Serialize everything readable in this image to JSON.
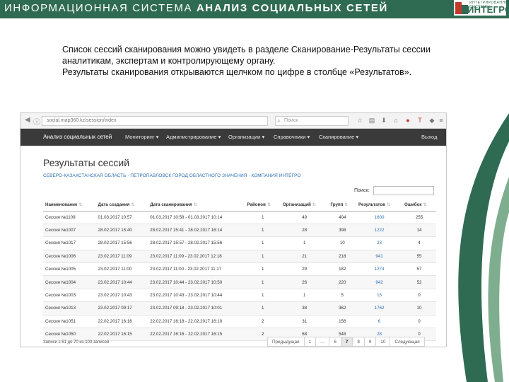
{
  "header": {
    "title_regular": "ИНФОРМАЦИОННАЯ СИСТЕМА ",
    "title_bold": "АНАЛИЗ СОЦИАЛЬНЫХ СЕТЕЙ",
    "logo_top": "ИНТЕГРИРОВАННЫЕ СИСТЕМЫ",
    "logo_text": "ИНТЕГРО"
  },
  "colors": {
    "brand_green": "#2f6b53",
    "link_blue": "#2a6fb5",
    "nav_dark": "#3a3a3a"
  },
  "description": {
    "line1": "Список сессий сканирования можно увидеть в разделе Сканирование-Результаты сессии",
    "line2": "аналитикам, экспертам и контролирующему органу.",
    "line3": "Результаты сканирования открываются щелчком по цифре в столбце «Результатов»."
  },
  "browser": {
    "address": "social.map360.kz/session/index",
    "search_placeholder": "Поиск",
    "toolbar_icons": [
      "star-icon",
      "reading-list-icon",
      "download-icon",
      "home-icon",
      "pocket-icon",
      "menu-icon"
    ]
  },
  "nav": {
    "brand": "Анализ социальных сетей",
    "items": [
      "Мониторинг ▾",
      "Администрирование ▾",
      "Организации ▾",
      "Справочники ▾",
      "Сканирование ▾"
    ],
    "logout": "Выход"
  },
  "page": {
    "title": "Результаты сессий",
    "breadcrumb": "СЕВЕРО-КАЗАХСТАНСКАЯ ОБЛАСТЬ  ·  ПЕТРОПАВЛОВСК ГОРОД ОБЛАСТНОГО ЗНАЧЕНИЯ  ·  КОМПАНИЯ ИНТЕГРО",
    "search_label": "Поиск:"
  },
  "table": {
    "headers": [
      "Наименование",
      "Дата создания",
      "Дата сканирования",
      "Районов",
      "Организаций",
      "Групп",
      "Результатов",
      "Ошибок"
    ],
    "rows": [
      [
        "Сессия №1109",
        "01.03.2017 10:57",
        "01.03.2017 10:58 - 01.03.2017 10:14",
        "1",
        "49",
        "404",
        "1600",
        "255"
      ],
      [
        "Сессия №1007",
        "28.02.2017 15:40",
        "28.02.2017 15:41 - 28.02.2017 16:14",
        "1",
        "28",
        "398",
        "1222",
        "14"
      ],
      [
        "Сессия №1017",
        "28.02.2017 15:56",
        "28.02.2017 15:57 - 28.02.2017 15:56",
        "1",
        "1",
        "10",
        "23",
        "4"
      ],
      [
        "Сессия №1006",
        "23.02.2017 11:09",
        "23.02.2017 11:09 - 23.02.2017 12:18",
        "1",
        "21",
        "218",
        "941",
        "55"
      ],
      [
        "Сессия №1005",
        "23.02.2017 11:00",
        "23.02.2017 11:00 - 23.02.2017 11:17",
        "1",
        "29",
        "182",
        "1274",
        "57"
      ],
      [
        "Сессия №1004",
        "23.02.2017 10:44",
        "23.02.2017 10:44 - 23.02.2017 10:50",
        "1",
        "26",
        "220",
        "942",
        "52"
      ],
      [
        "Сессия №1003",
        "23.02.2017 10:43",
        "23.02.2017 10:43 - 23.02.2017 10:44",
        "1",
        "1",
        "5",
        "15",
        "0"
      ],
      [
        "Сессия №1013",
        "23.02.2017 09:17",
        "23.02.2017 09:18 - 23.02.2017 10:01",
        "1",
        "38",
        "362",
        "1762",
        "10"
      ],
      [
        "Сессия №1051",
        "22.02.2017 16:16",
        "22.02.2017 16:18 - 22.02.2017 16:10",
        "2",
        "31",
        "156",
        "6",
        "0"
      ],
      [
        "Сессия №1050",
        "22.02.2017 16:15",
        "22.02.2017 16:16 - 22.02.2017 16:15",
        "2",
        "68",
        "548",
        "28",
        "0"
      ]
    ]
  },
  "footer": {
    "info": "Записи с 61 до 70 из 100 записей",
    "pages": [
      "Предыдущая",
      "1",
      "…",
      "6",
      "7",
      "8",
      "9",
      "10",
      "Следующая"
    ],
    "active_page": "7"
  }
}
